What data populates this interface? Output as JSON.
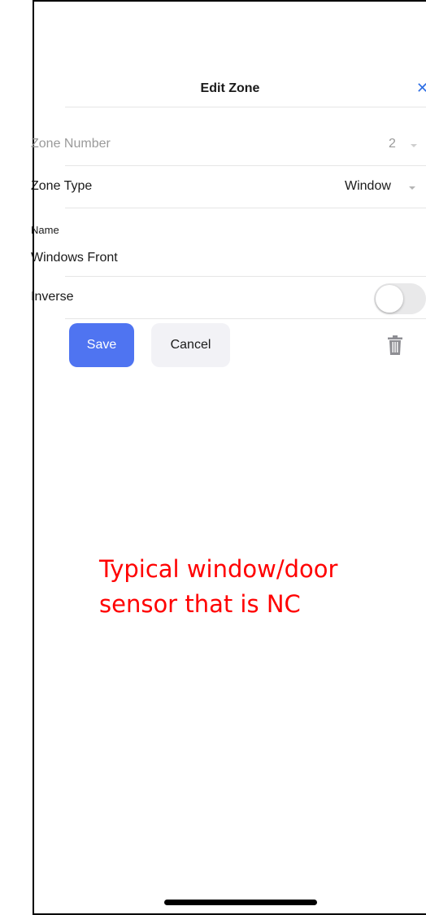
{
  "header": {
    "title": "Edit Zone",
    "close_symbol": "✕"
  },
  "form": {
    "zone_number": {
      "label": "Zone Number",
      "value": "2",
      "disabled": true
    },
    "zone_type": {
      "label": "Zone Type",
      "value": "Window"
    },
    "name": {
      "label": "Name",
      "value": "Windows Front"
    },
    "inverse": {
      "label": "Inverse",
      "on": false
    }
  },
  "actions": {
    "save_label": "Save",
    "cancel_label": "Cancel",
    "delete_icon": "trash-icon"
  },
  "annotation": {
    "text": "Typical window/door sensor that is NC",
    "color": "#ff0000"
  },
  "colors": {
    "accent": "#4f74f1",
    "close": "#2f6fe4"
  }
}
